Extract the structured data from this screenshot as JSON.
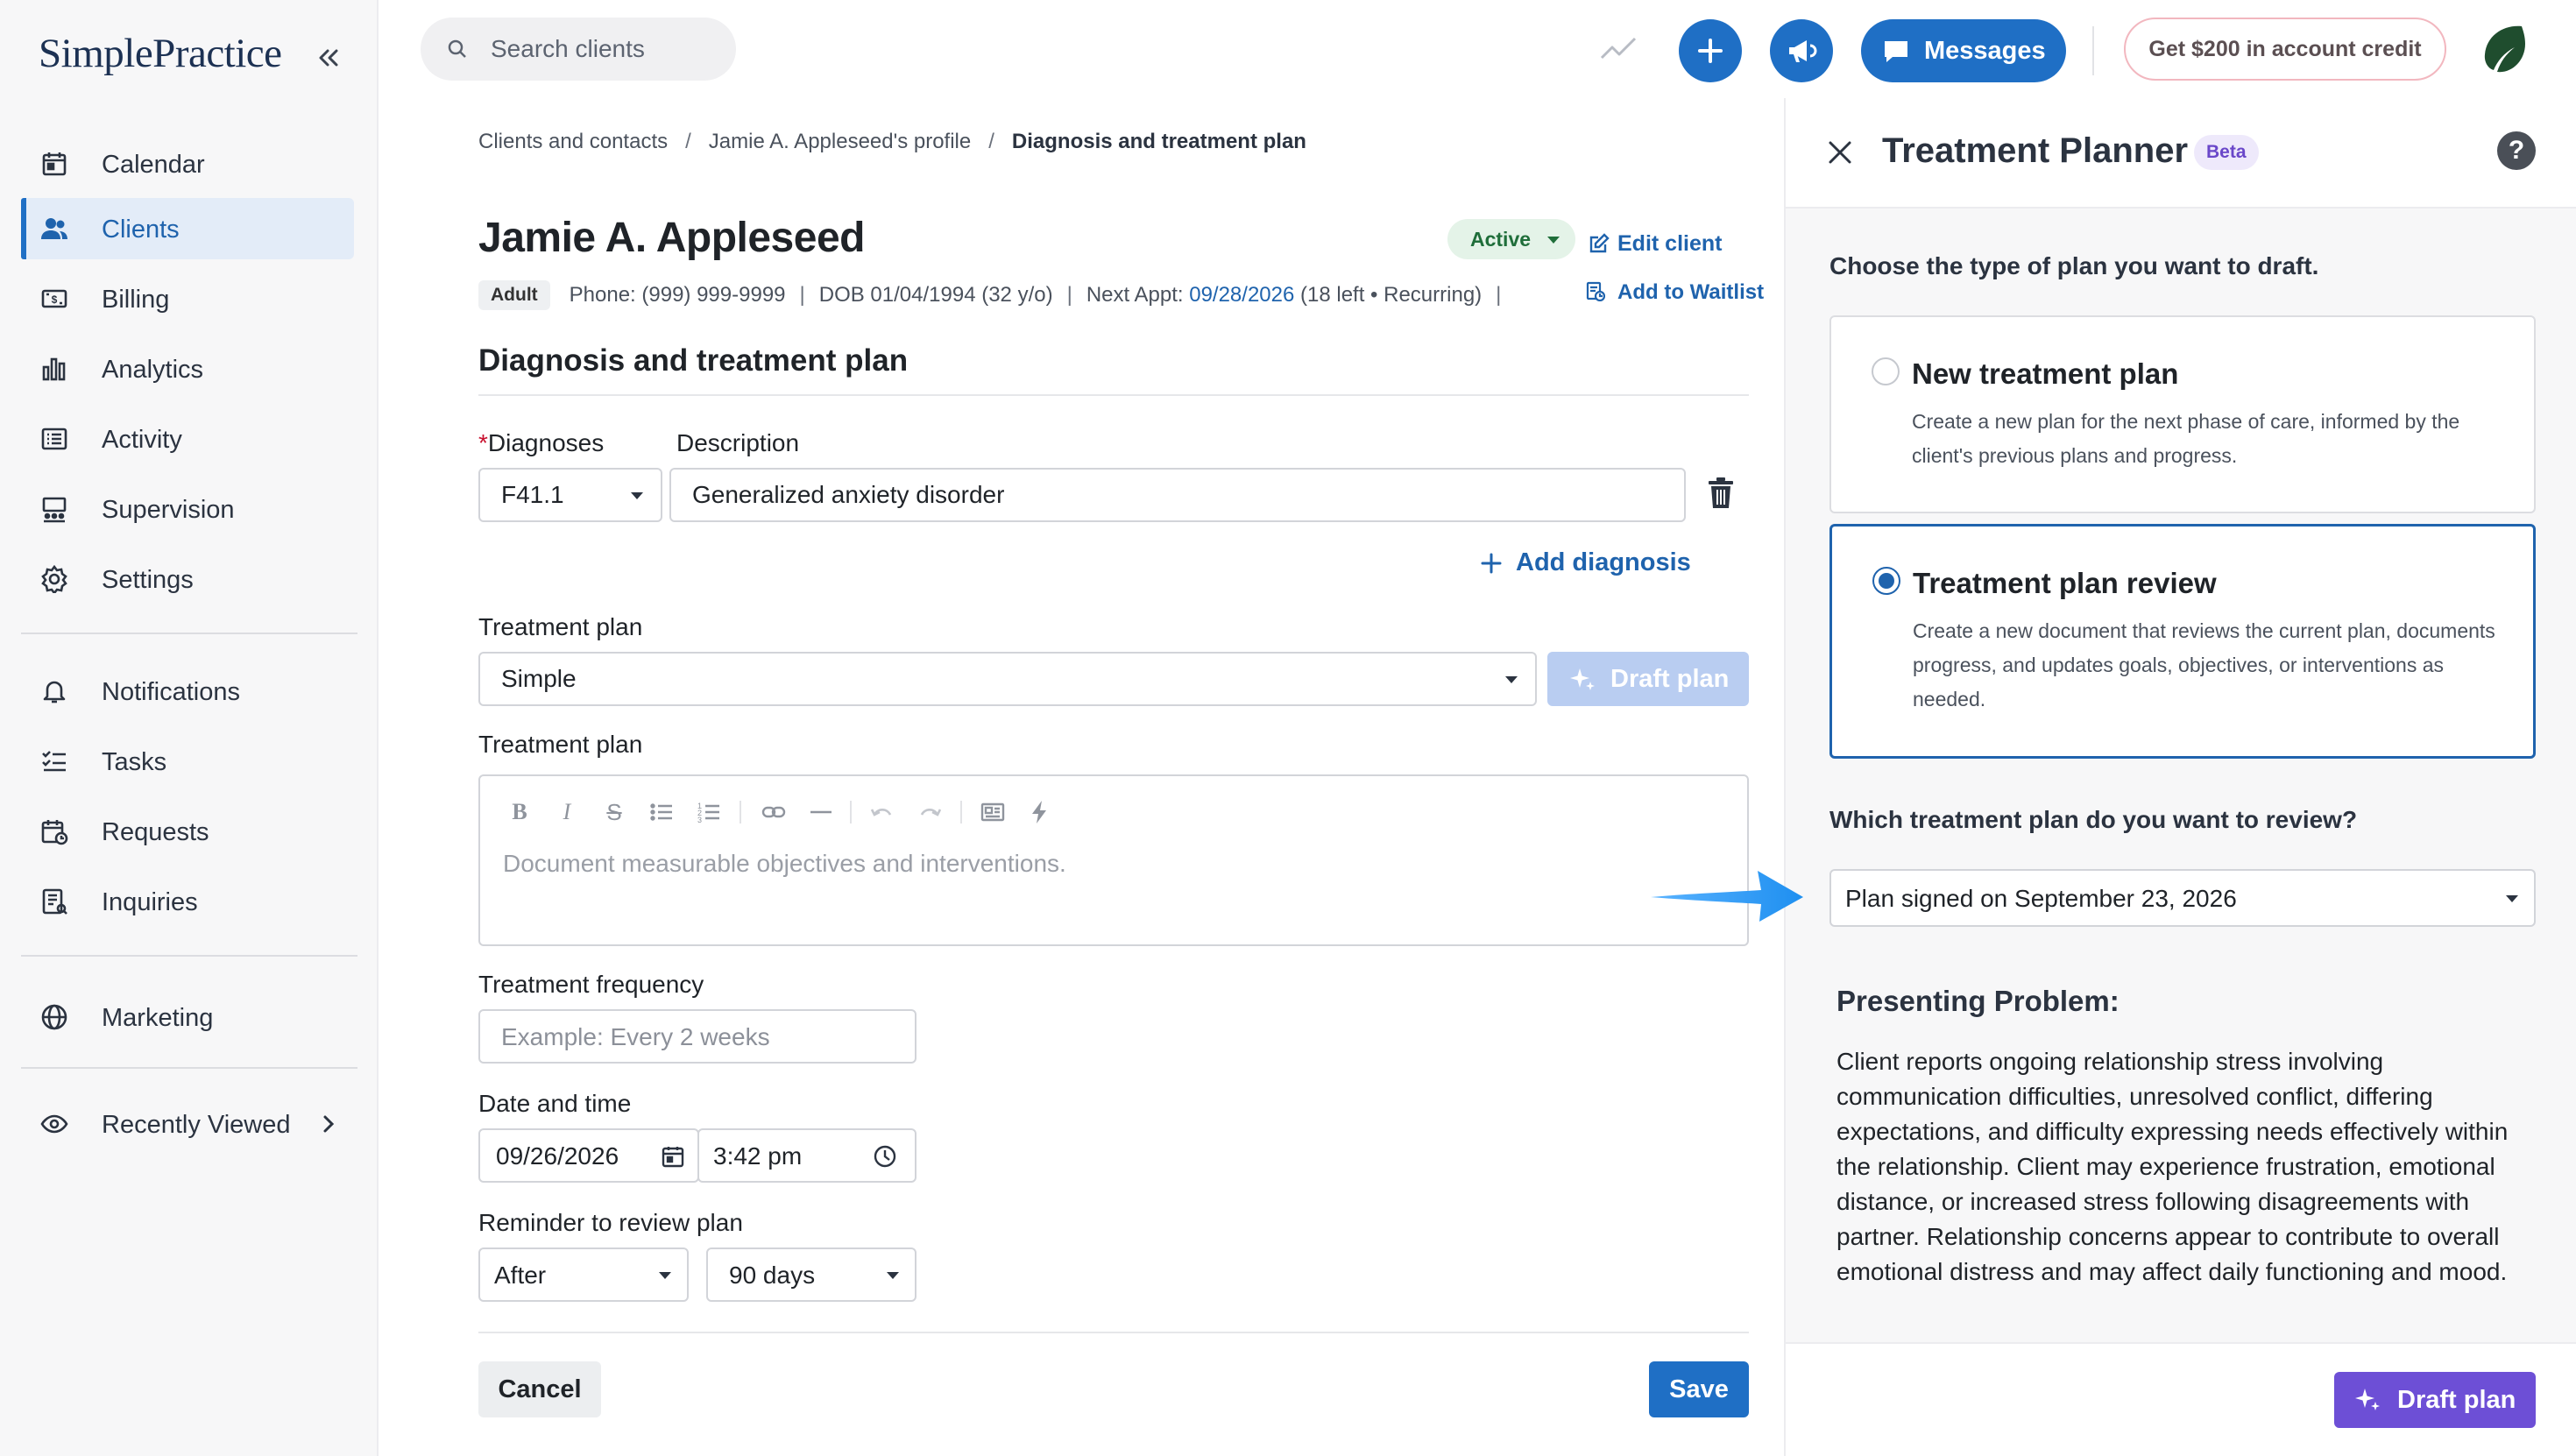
{
  "app": {
    "logo": "SimplePractice"
  },
  "sidebar": {
    "items": [
      {
        "label": "Calendar",
        "icon": "calendar-icon"
      },
      {
        "label": "Clients",
        "icon": "clients-icon",
        "active": true
      },
      {
        "label": "Billing",
        "icon": "billing-icon"
      },
      {
        "label": "Analytics",
        "icon": "analytics-icon"
      },
      {
        "label": "Activity",
        "icon": "activity-icon"
      },
      {
        "label": "Supervision",
        "icon": "supervision-icon"
      },
      {
        "label": "Settings",
        "icon": "gear-icon"
      },
      {
        "label": "Notifications",
        "icon": "bell-icon"
      },
      {
        "label": "Tasks",
        "icon": "tasks-icon"
      },
      {
        "label": "Requests",
        "icon": "requests-icon"
      },
      {
        "label": "Inquiries",
        "icon": "inquiries-icon"
      },
      {
        "label": "Marketing",
        "icon": "globe-icon"
      },
      {
        "label": "Recently Viewed",
        "icon": "eye-icon"
      }
    ]
  },
  "topbar": {
    "search_placeholder": "Search clients",
    "messages_label": "Messages",
    "credit_label": "Get $200 in account credit"
  },
  "breadcrumb": {
    "items": [
      "Clients and contacts",
      "Jamie A. Appleseed's profile",
      "Diagnosis and treatment plan"
    ]
  },
  "client": {
    "name": "Jamie A. Appleseed",
    "status": "Active",
    "edit_label": "Edit client",
    "type": "Adult",
    "phone": "Phone: (999) 999-9999",
    "dob": "DOB 01/04/1994 (32 y/o)",
    "next_appt_label": "Next Appt:",
    "next_appt_date": "09/28/2026",
    "next_appt_detail": "(18 left • Recurring)",
    "waitlist_label": "Add to Waitlist"
  },
  "form": {
    "section_title": "Diagnosis and treatment plan",
    "diagnoses_required": "*",
    "diagnoses_label": "Diagnoses",
    "description_label": "Description",
    "diagnosis_code": "F41.1",
    "diagnosis_description": "Generalized anxiety disorder",
    "add_diagnosis_label": "Add diagnosis",
    "treatment_plan_label": "Treatment plan",
    "treatment_plan_value": "Simple",
    "draft_plan_label": "Draft plan",
    "treatment_plan_text_label": "Treatment plan",
    "editor_placeholder": "Document measurable objectives and interventions.",
    "frequency_label": "Treatment frequency",
    "frequency_placeholder": "Example: Every 2 weeks",
    "datetime_label": "Date and time",
    "date_value": "09/26/2026",
    "time_value": "3:42 pm",
    "reminder_label": "Reminder to review plan",
    "reminder_when": "After",
    "reminder_days": "90 days",
    "cancel_label": "Cancel",
    "save_label": "Save"
  },
  "planner": {
    "title": "Treatment Planner",
    "badge": "Beta",
    "help": "?",
    "question": "Choose the type of plan you want to draft.",
    "options": [
      {
        "title": "New treatment plan",
        "description": "Create a new plan for the next phase of care, informed by the client's previous plans and progress.",
        "selected": false
      },
      {
        "title": "Treatment plan review",
        "description": "Create a new document that reviews the current plan, documents progress, and updates goals, objectives, or interventions as needed.",
        "selected": true
      }
    ],
    "review_question": "Which treatment plan do you want to review?",
    "review_select": "Plan signed on September 23, 2026",
    "presenting_title": "Presenting Problem:",
    "presenting_text": "Client reports ongoing relationship stress involving communication difficulties, unresolved conflict, differing expectations, and difficulty expressing needs effectively within the relationship. Client may experience frustration, emotional distance, or increased stress following disagreements with partner. Relationship concerns appear to contribute to overall emotional distress and may affect daily functioning and mood.",
    "draft_label": "Draft plan"
  },
  "colors": {
    "primary": "#1f6fc5",
    "accent_purple": "#6d4fd6",
    "active_status": "#1f6e3a",
    "arrow": "#1e8ff0"
  }
}
